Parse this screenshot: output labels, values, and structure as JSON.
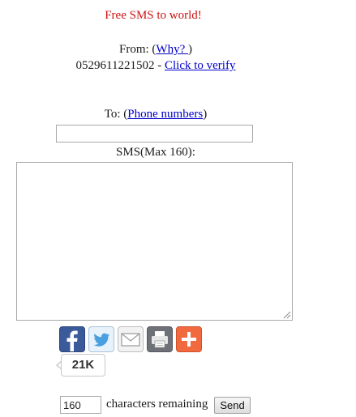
{
  "header": {
    "title": "Free SMS to world!"
  },
  "sender": {
    "from_label": "From: (",
    "why_link": "Why? ",
    "from_close": ")",
    "phone_number": "0529611221502",
    "separator": " - ",
    "verify_link": "Click to verify"
  },
  "recipient": {
    "to_label": "To: (",
    "phone_numbers_link": "Phone numbers",
    "to_close": ")",
    "value": ""
  },
  "message": {
    "label": "SMS(Max 160):",
    "value": ""
  },
  "share": {
    "buttons": [
      {
        "name": "facebook",
        "icon": "facebook-icon",
        "color": "#3b5a9a"
      },
      {
        "name": "twitter",
        "icon": "twitter-icon",
        "color": "#55acee"
      },
      {
        "name": "email",
        "icon": "email-icon",
        "color": "#f2f2f2"
      },
      {
        "name": "print",
        "icon": "print-icon",
        "color": "#6e7278"
      },
      {
        "name": "more",
        "icon": "plus-icon",
        "color": "#f0693f"
      }
    ],
    "count": "21K"
  },
  "footer": {
    "characters_remaining": "160",
    "remaining_label": "characters remaining",
    "send_label": "Send"
  }
}
